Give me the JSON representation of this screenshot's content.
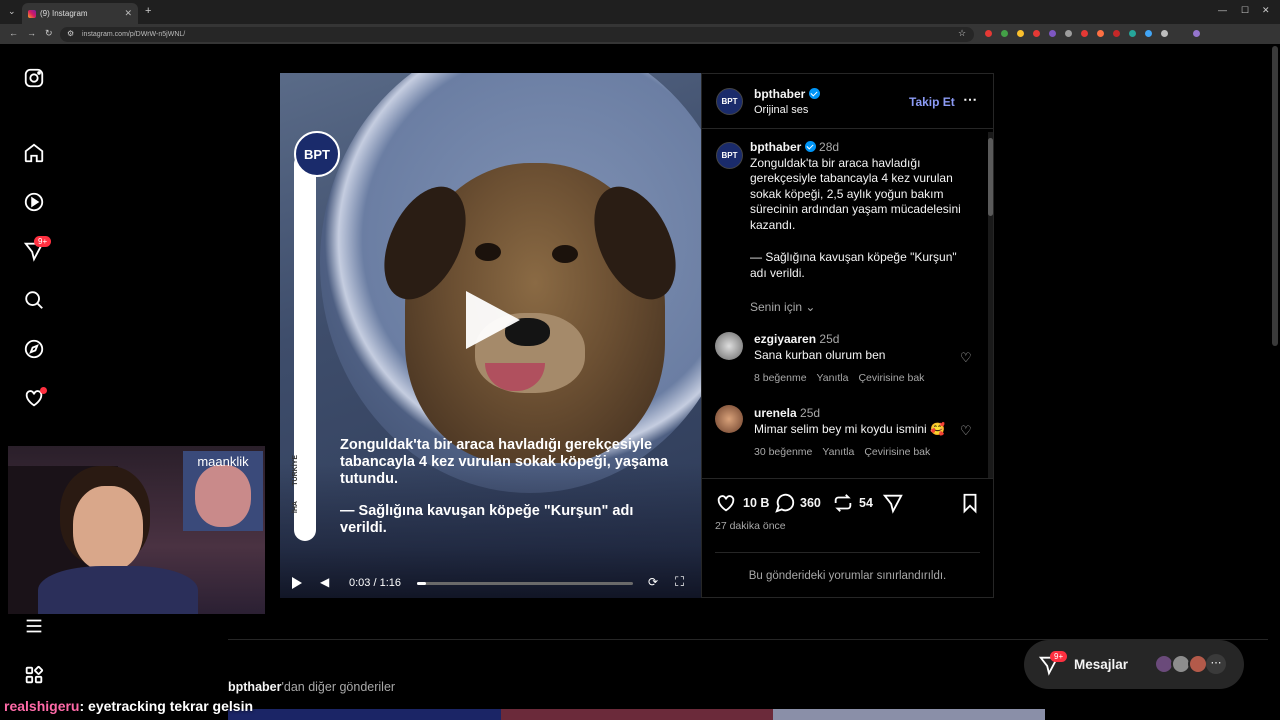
{
  "browser": {
    "tab_title": "(9) Instagram",
    "url": "instagram.com/p/DWrW-n5jWNL/"
  },
  "sidebar": {
    "notification_badge": "9+"
  },
  "video": {
    "logo_text": "BPT",
    "vertical_label_top": "TÜRKİYE",
    "vertical_label_bottom": "İHA",
    "headline": "Zonguldak'ta bir araca havladığı gerekçesiyle tabancayla 4 kez vurulan sokak köpeği, yaşama tutundu.",
    "subline": "— Sağlığına kavuşan köpeğe \"Kurşun\" adı verildi.",
    "time": "0:03 / 1:16",
    "progress": 0.04
  },
  "post": {
    "username": "bpthaber",
    "audio": "Orijinal ses",
    "follow": "Takip Et",
    "caption_user": "bpthaber",
    "caption_age": "28d",
    "caption": "Zonguldak'ta bir araca havladığı gerekçesiyle tabancayla 4 kez vurulan sokak köpeği, 2,5 aylık yoğun bakım sürecinin ardından yaşam mücadelesini kazandı.",
    "caption2": "— Sağlığına kavuşan köpeğe \"Kurşun\" adı verildi.",
    "for_you": "Senin için",
    "comments": [
      {
        "user": "ezgiyaaren",
        "age": "25d",
        "text": "Sana kurban olurum ben",
        "likes": "8 beğenme",
        "reply": "Yanıtla",
        "translate": "Çevirisine bak"
      },
      {
        "user": "urenela",
        "age": "25d",
        "text": "Mimar selim bey mi koydu ismini 🥰",
        "likes": "30 beğenme",
        "reply": "Yanıtla",
        "translate": "Çevirisine bak"
      }
    ],
    "like_count": "10 B",
    "comment_count": "360",
    "repost_count": "54",
    "time_ago": "27 dakika önce",
    "comments_limited": "Bu gönderideki yorumlar sınırlandırıldı."
  },
  "more_posts": {
    "user": "bpthaber",
    "suffix": "'dan diğer gönderiler"
  },
  "messages": {
    "label": "Mesajlar",
    "badge": "9+"
  },
  "stream": {
    "cam_name": "maanklik",
    "chat_user": "realshigeru",
    "chat_text": ": eyetracking tekrar gelsin"
  }
}
